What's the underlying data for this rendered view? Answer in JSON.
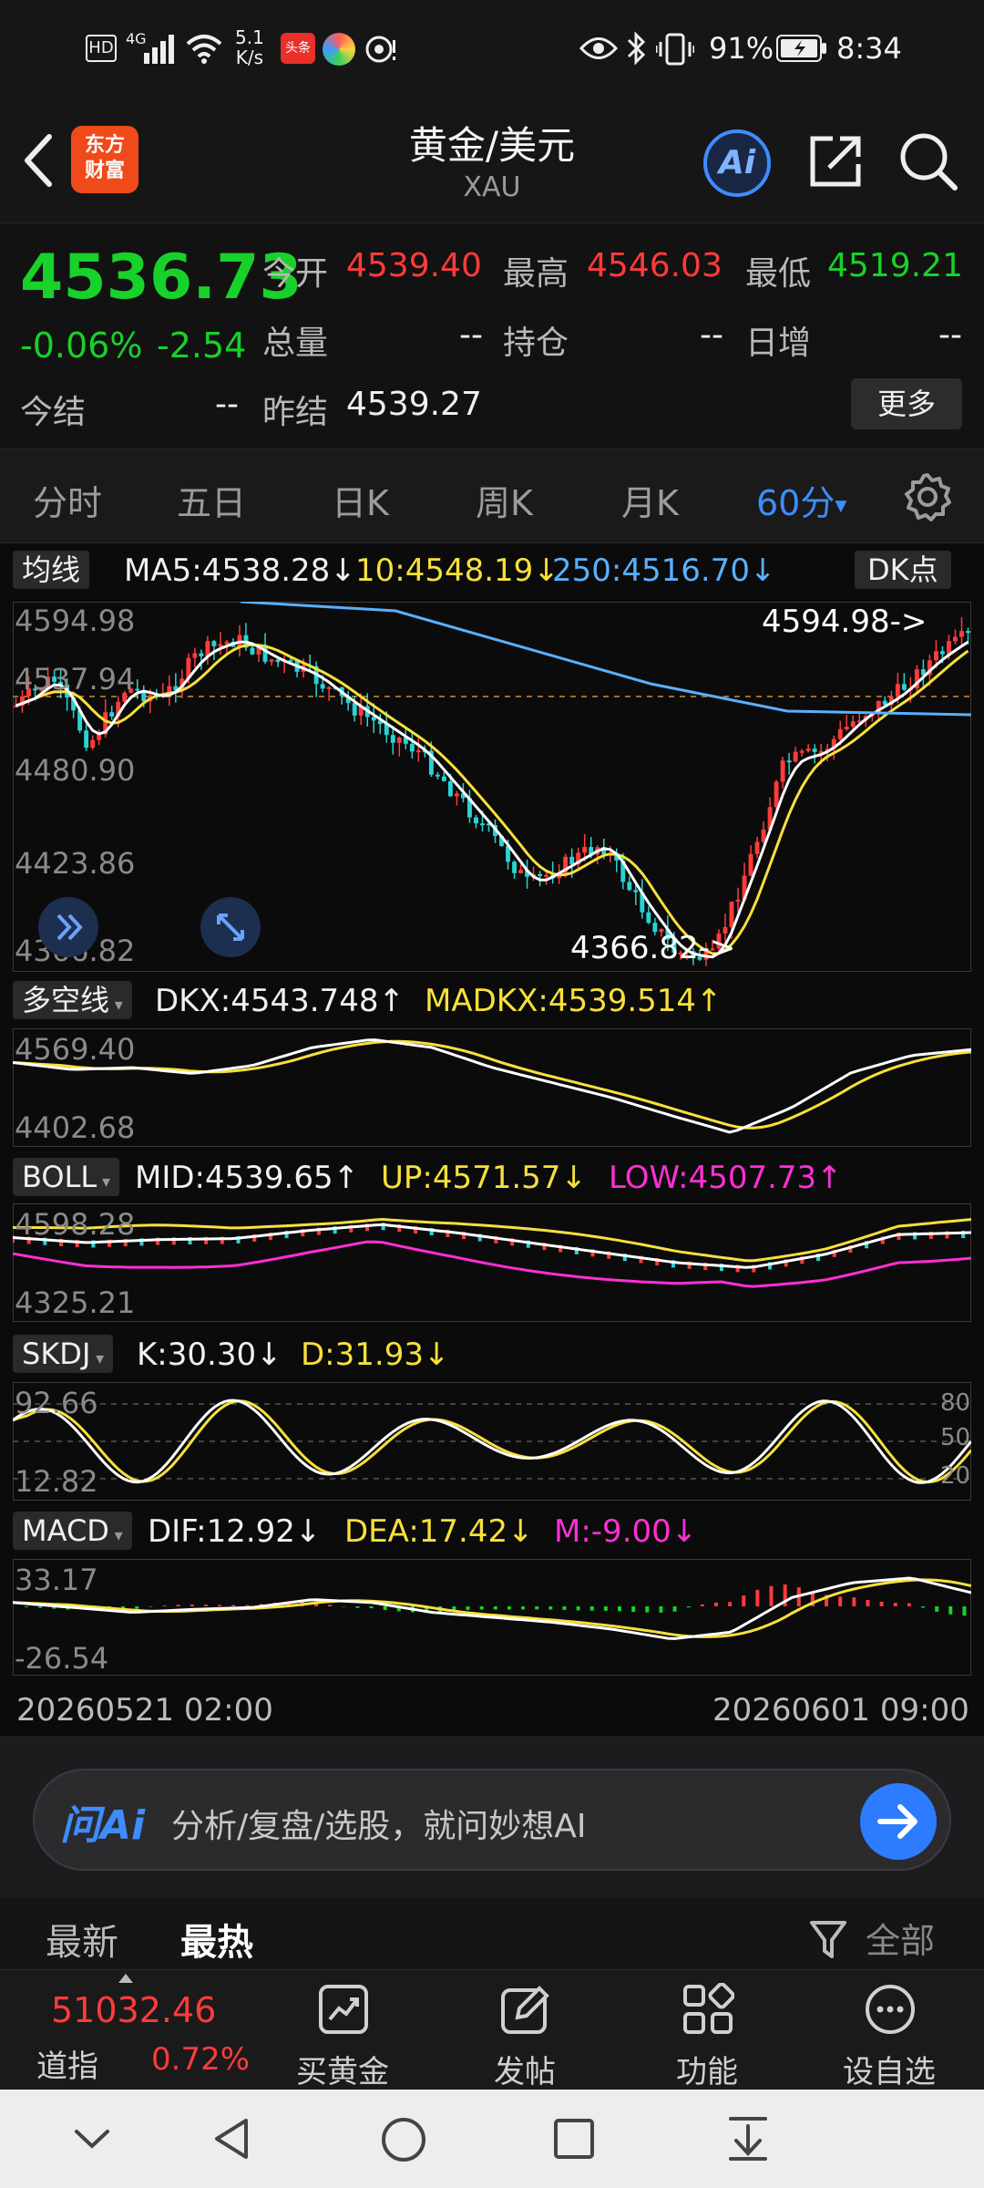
{
  "status_bar": {
    "hd": "HD",
    "network": "4G",
    "speed_value": "5.1",
    "speed_unit": "K/s",
    "app_badge": "头条",
    "battery_pct": "91%",
    "time": "8:34"
  },
  "header": {
    "brand_line1": "东方",
    "brand_line2": "财富",
    "title": "黄金/美元",
    "subtitle": "XAU",
    "ai_label": "Ai"
  },
  "quote": {
    "price": "4536.73",
    "change_pct": "-0.06%",
    "change": "-2.54",
    "open_label": "今开",
    "open": "4539.40",
    "high_label": "最高",
    "high": "4546.03",
    "low_label": "最低",
    "low": "4519.21",
    "volume_label": "总量",
    "volume": "--",
    "position_label": "持仓",
    "position": "--",
    "daily_inc_label": "日增",
    "daily_inc": "--",
    "settle_label": "今结",
    "settle": "--",
    "prev_settle_label": "昨结",
    "prev_settle": "4539.27",
    "more_button": "更多"
  },
  "periods": {
    "tabs": [
      "分时",
      "五日",
      "日K",
      "周K",
      "月K"
    ],
    "active": "60分",
    "active_arrow": "▾"
  },
  "main_chart": {
    "selector": "均线",
    "ma5": "MA5:4538.28↓",
    "ma10": "10:4548.19↓",
    "ma250": "250:4516.70↓",
    "dk_button": "DK点",
    "axis": [
      "4594.98",
      "4537.94",
      "4480.90",
      "4423.86",
      "4366.82"
    ],
    "high_marker": "4594.98->",
    "low_marker": "4366.82->"
  },
  "dkx": {
    "selector": "多空线",
    "dkx": "DKX:4543.748↑",
    "madkx": "MADKX:4539.514↑",
    "axis": [
      "4569.40",
      "4402.68"
    ]
  },
  "boll": {
    "selector": "BOLL",
    "mid": "MID:4539.65↑",
    "up": "UP:4571.57↓",
    "low": "LOW:4507.73↑",
    "axis": [
      "4598.28",
      "4325.21"
    ]
  },
  "skdj": {
    "selector": "SKDJ",
    "k": "K:30.30↓",
    "d": "D:31.93↓",
    "axis": [
      "92.66",
      "12.82"
    ],
    "right_axis": [
      "80",
      "50",
      "20"
    ]
  },
  "macd": {
    "selector": "MACD",
    "dif": "DIF:12.92↓",
    "dea": "DEA:17.42↓",
    "m": "M:-9.00↓",
    "axis": [
      "33.17",
      "-26.54"
    ]
  },
  "time_axis": {
    "start": "20260521 02:00",
    "end": "20260601 09:00"
  },
  "ai_bar": {
    "logo": "问Ai",
    "placeholder": "分析/复盘/选股，就问妙想AI"
  },
  "feed_tabs": {
    "latest": "最新",
    "hottest": "最热",
    "filter": "全部"
  },
  "toolbar": {
    "index_value": "51032.46",
    "index_name": "道指",
    "index_change": "0.72%",
    "items": [
      "买黄金",
      "发帖",
      "功能",
      "设自选"
    ]
  },
  "colors": {
    "up": "#ff3b3b",
    "down": "#18d12a",
    "ma5": "#ffffff",
    "ma10": "#f7e03c",
    "ma250": "#5ab0ff",
    "accent": "#2d7cff",
    "low_band": "#ff2fd5"
  }
}
